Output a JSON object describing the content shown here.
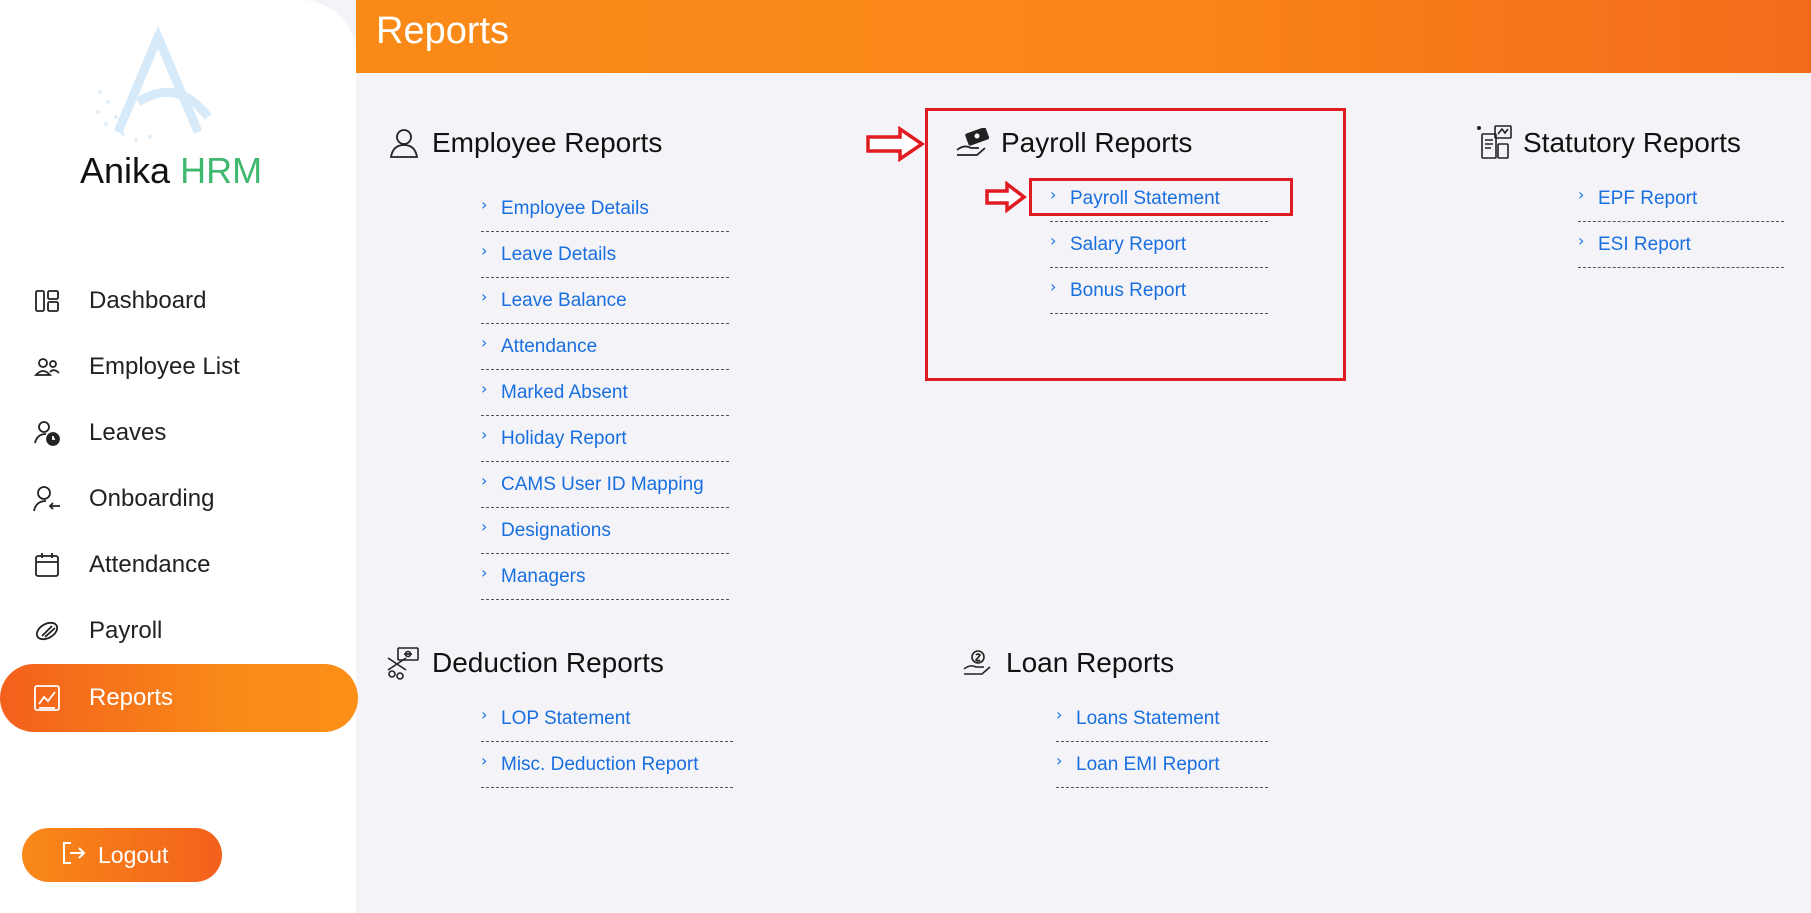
{
  "brand": {
    "name": "Anika",
    "suffix": "HRM"
  },
  "sidebar": {
    "items": [
      {
        "label": "Dashboard",
        "icon": "dashboard-icon"
      },
      {
        "label": "Employee List",
        "icon": "users-icon"
      },
      {
        "label": "Leaves",
        "icon": "user-clock-icon"
      },
      {
        "label": "Onboarding",
        "icon": "user-arrow-icon"
      },
      {
        "label": "Attendance",
        "icon": "calendar-icon"
      },
      {
        "label": "Payroll",
        "icon": "money-icon"
      },
      {
        "label": "Reports",
        "icon": "chart-icon",
        "active": true
      }
    ],
    "logout_label": "Logout"
  },
  "header": {
    "title": "Reports"
  },
  "sections": {
    "employee": {
      "title": "Employee Reports",
      "links": [
        "Employee Details",
        "Leave Details",
        "Leave Balance",
        "Attendance",
        "Marked Absent",
        "Holiday Report",
        "CAMS User ID Mapping",
        "Designations",
        "Managers"
      ]
    },
    "payroll": {
      "title": "Payroll Reports",
      "links": [
        "Payroll Statement",
        "Salary Report",
        "Bonus Report"
      ]
    },
    "statutory": {
      "title": "Statutory Reports",
      "links": [
        "EPF Report",
        "ESI Report"
      ]
    },
    "deduction": {
      "title": "Deduction Reports",
      "links": [
        "LOP Statement",
        "Misc. Deduction Report"
      ]
    },
    "loan": {
      "title": "Loan Reports",
      "links": [
        "Loans Statement",
        "Loan EMI Report"
      ]
    }
  },
  "colors": {
    "accent": "#f98a18",
    "accent_dark": "#f3601c",
    "link": "#1a6fe0",
    "brand_green": "#3fb870",
    "annotation_red": "#e01b22"
  }
}
